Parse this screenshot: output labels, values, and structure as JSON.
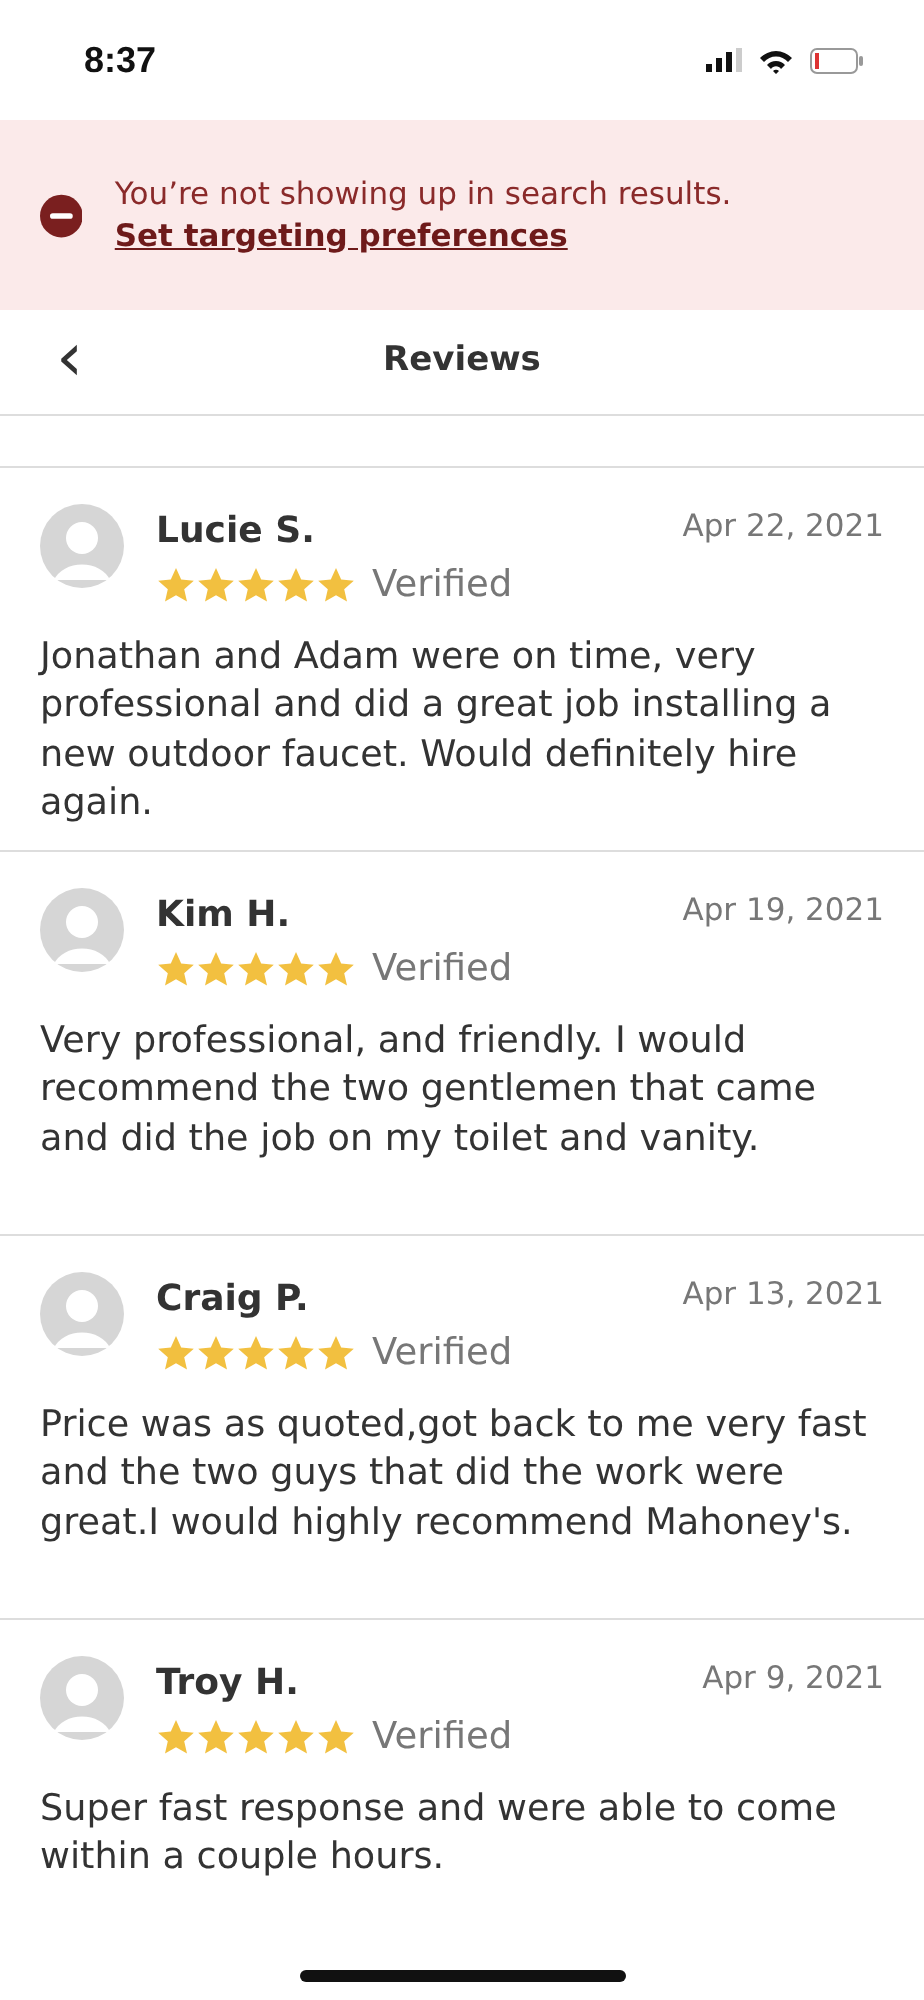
{
  "status_bar": {
    "time": "8:37"
  },
  "banner": {
    "message": "You’re not showing up in search results.",
    "link": "Set targeting preferences"
  },
  "header": {
    "back": "‹",
    "title": "Reviews"
  },
  "reviews": [
    {
      "name": "Lucie S.",
      "date": "Apr 22, 2021",
      "stars": 5,
      "verified": "Verified",
      "text": "Jonathan and Adam were on time, very professional and did a great job installing a new outdoor faucet. Would definitely hire again."
    },
    {
      "name": "Kim H.",
      "date": "Apr 19, 2021",
      "stars": 5,
      "verified": "Verified",
      "text": "Very professional, and friendly. I would recommend the two gentlemen that came and did the job on my toilet and vanity."
    },
    {
      "name": "Craig P.",
      "date": "Apr 13, 2021",
      "stars": 5,
      "verified": "Verified",
      "text": "Price was as quoted,got back to me very fast and the two guys that did the work were great.I would highly recommend Mahoney's."
    },
    {
      "name": "Troy H.",
      "date": "Apr 9, 2021",
      "stars": 5,
      "verified": "Verified",
      "text": "Super fast response and were able to come within a couple hours."
    }
  ]
}
